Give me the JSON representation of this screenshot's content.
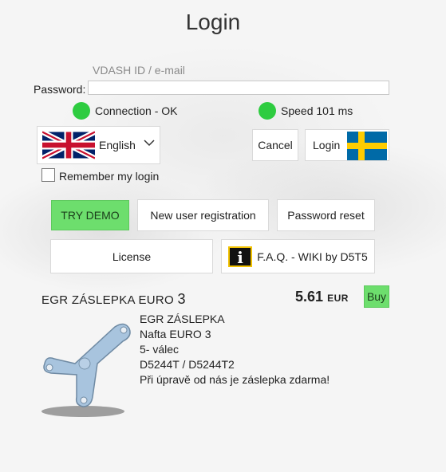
{
  "title": "Login",
  "form": {
    "id_label": "VDASH ID / e-mail",
    "password_label": "Password:",
    "password_value": ""
  },
  "status": {
    "connection": "Connection - OK",
    "speed": "Speed 101 ms",
    "color": "#2ecc40"
  },
  "language": {
    "selected": "English",
    "flag_icon": "uk-flag-icon"
  },
  "buttons": {
    "cancel": "Cancel",
    "login": "Login",
    "try_demo": "TRY DEMO",
    "new_registration": "New user registration",
    "password_reset": "Password reset",
    "license": "License",
    "faq": "F.A.Q. - WIKI by D5T5",
    "buy": "Buy"
  },
  "remember": {
    "label": "Remember my login",
    "checked": false
  },
  "product": {
    "title_text": "EGR ZÁSLEPKA EURO",
    "title_num": "3",
    "price": "5.61",
    "currency": "EUR",
    "description": [
      "EGR ZÁSLEPKA",
      "Nafta EURO 3",
      "5- válec",
      "D5244T / D5244T2",
      "Při úpravě od nás je záslepka zdarma!"
    ]
  },
  "colors": {
    "accent_green": "#6dde6d",
    "status_green": "#2ecc40"
  }
}
